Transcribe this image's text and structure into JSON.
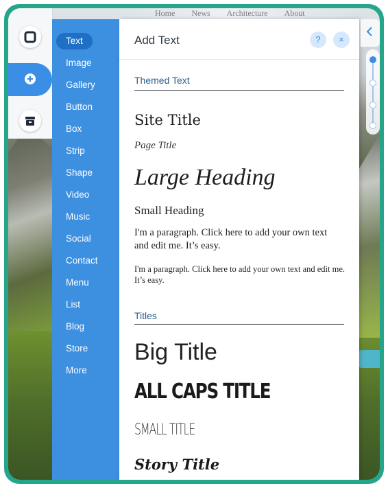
{
  "site_nav": [
    "Home",
    "News",
    "Architecture",
    "About"
  ],
  "categories": [
    {
      "label": "Text",
      "active": true
    },
    {
      "label": "Image"
    },
    {
      "label": "Gallery"
    },
    {
      "label": "Button"
    },
    {
      "label": "Box"
    },
    {
      "label": "Strip"
    },
    {
      "label": "Shape"
    },
    {
      "label": "Video"
    },
    {
      "label": "Music"
    },
    {
      "label": "Social"
    },
    {
      "label": "Contact"
    },
    {
      "label": "Menu"
    },
    {
      "label": "List"
    },
    {
      "label": "Blog"
    },
    {
      "label": "Store"
    },
    {
      "label": "More"
    }
  ],
  "panel": {
    "title": "Add Text",
    "help_icon": "?",
    "close_icon": "×",
    "sections": {
      "themed": "Themed Text",
      "titles": "Titles"
    },
    "themed_items": {
      "site_title": "Site Title",
      "page_title": "Page Title",
      "large_heading": "Large Heading",
      "small_heading": "Small Heading",
      "paragraph_1": "I'm a paragraph. Click here to add your own text and edit me. It’s easy.",
      "paragraph_2": "I'm a paragraph. Click here to add your own text and edit me. It’s easy."
    },
    "title_items": {
      "big_title": "Big Title",
      "all_caps_title": "ALL CAPS TITLE",
      "small_title": "SMALL TITLE",
      "story_title": "Story Title"
    }
  },
  "icons": {
    "tool_1": "square-icon",
    "tool_2": "plus-icon",
    "tool_3": "store-icon",
    "collapse": "chevron-left-icon"
  },
  "colors": {
    "frame": "#27a58b",
    "sidebar": "#3d8fe0",
    "active_pill": "#1f6fc7",
    "accent": "#3b8ee6"
  }
}
